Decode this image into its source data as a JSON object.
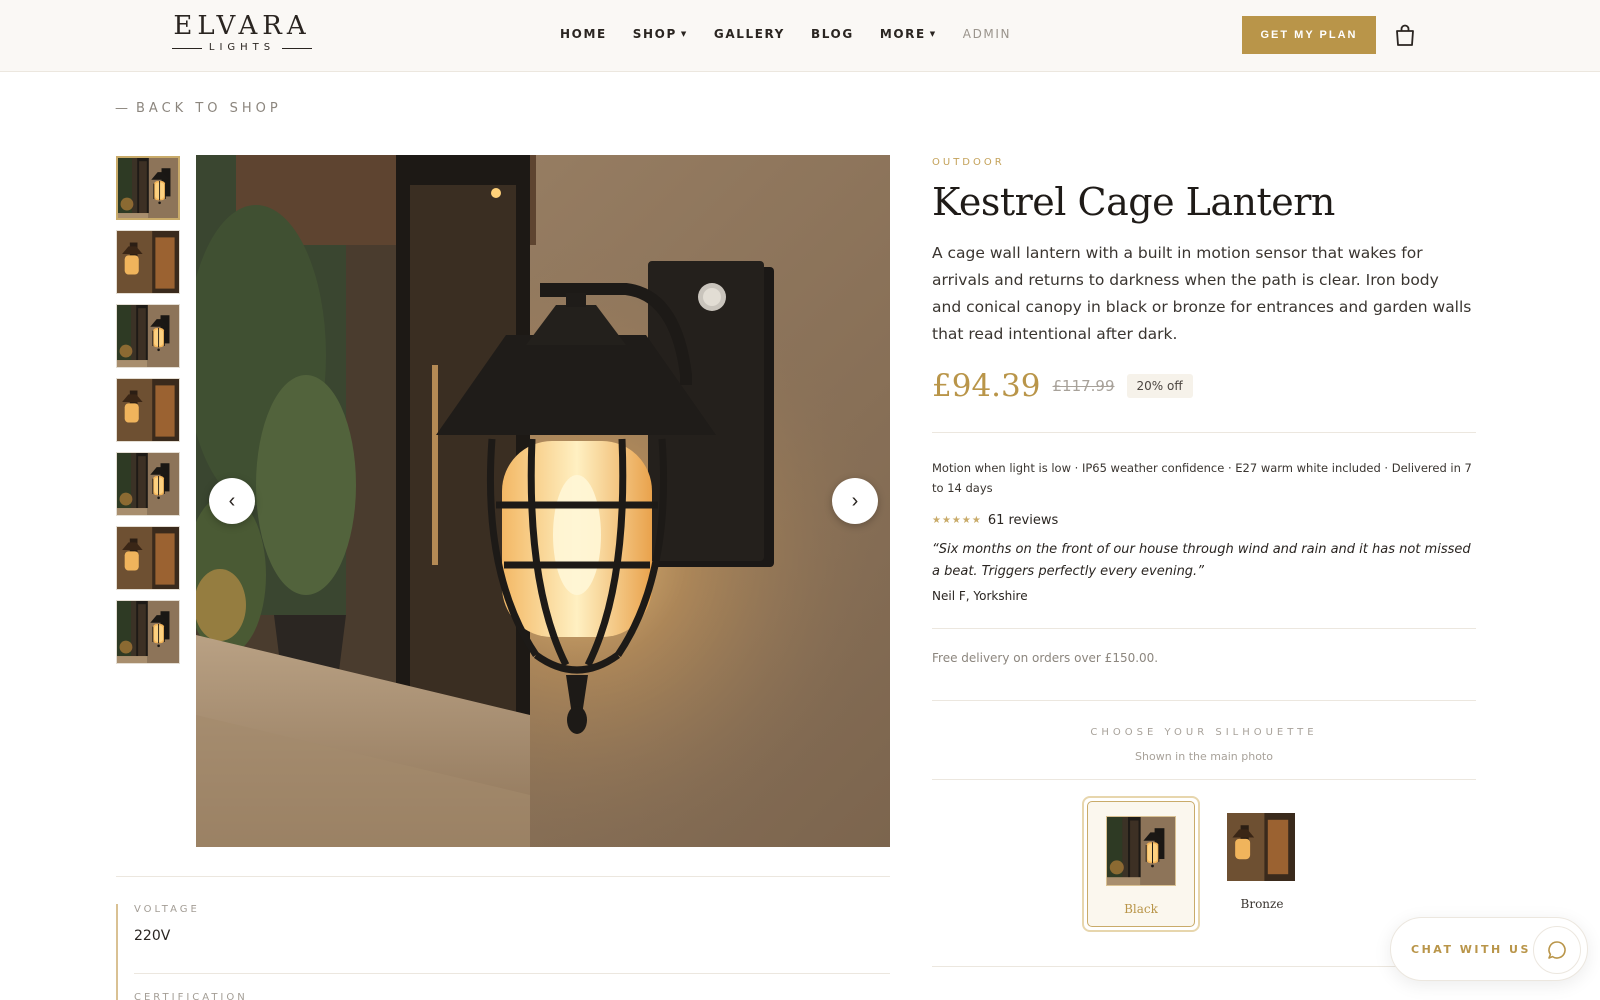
{
  "brand": {
    "name": "ELVARA",
    "tagline": "LIGHTS"
  },
  "nav": {
    "items": [
      {
        "label": "HOME",
        "dropdown": false
      },
      {
        "label": "SHOP",
        "dropdown": true
      },
      {
        "label": "GALLERY",
        "dropdown": false
      },
      {
        "label": "BLOG",
        "dropdown": false
      },
      {
        "label": "MORE",
        "dropdown": true
      },
      {
        "label": "ADMIN",
        "dropdown": false
      }
    ],
    "cta_label": "GET MY PLAN",
    "bag_icon": "shopping-bag-icon"
  },
  "back_link": "BACK TO SHOP",
  "gallery": {
    "thumbnail_count": 7,
    "active_index": 0,
    "prev_icon": "chevron-left-icon",
    "next_icon": "chevron-right-icon"
  },
  "specs": [
    {
      "label": "VOLTAGE",
      "value": "220V"
    },
    {
      "label": "CERTIFICATION",
      "value": ""
    }
  ],
  "product": {
    "category": "OUTDOOR",
    "title": "Kestrel Cage Lantern",
    "description": "A cage wall lantern with a built in motion sensor that wakes for arrivals and returns to darkness when the path is clear. Iron body and conical canopy in black or bronze for entrances and garden walls that read intentional after dark.",
    "price": "£94.39",
    "old_price": "£117.99",
    "discount": "20% off",
    "features": "Motion when light is low · IP65 weather confidence · E27 warm white included · Delivered in 7 to 14 days",
    "rating": {
      "stars": 5,
      "reviews": "61 reviews"
    },
    "testimonial": {
      "quote": "“Six months on the front of our house through wind and rain and it has not missed a beat. Triggers perfectly every evening.”",
      "author": "Neil F, Yorkshire"
    },
    "delivery": "Free delivery on orders over £150.00.",
    "silhouette": {
      "heading": "CHOOSE YOUR SILHOUETTE",
      "subheading": "Shown in the main photo",
      "options": [
        {
          "label": "Black",
          "selected": true
        },
        {
          "label": "Bronze",
          "selected": false
        }
      ]
    }
  },
  "chat": {
    "label": "CHAT WITH US",
    "icon": "chat-bubble-icon"
  },
  "colors": {
    "accent": "#b99549",
    "accent_light": "#c9ab6a",
    "ink": "#2a2521",
    "muted": "#8c867e",
    "header_bg": "#faf8f5"
  }
}
